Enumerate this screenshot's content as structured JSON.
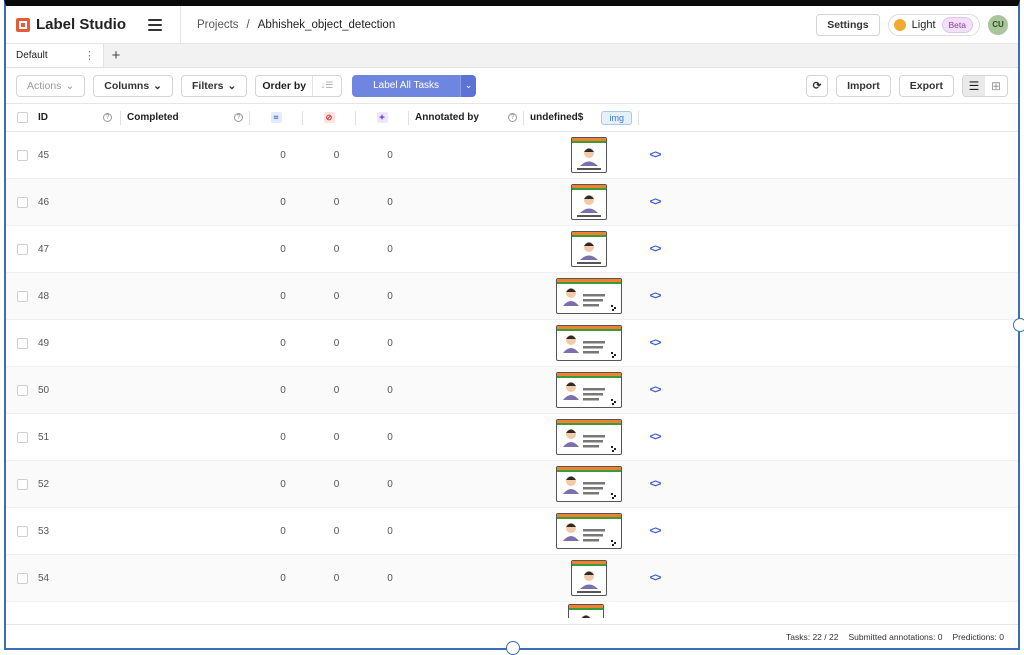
{
  "app": {
    "name": "Label Studio"
  },
  "breadcrumb": {
    "projects": "Projects",
    "separator": "/",
    "project": "Abhishek_object_detection"
  },
  "header": {
    "settings": "Settings",
    "theme": "Light",
    "beta": "Beta",
    "avatar": "CU"
  },
  "tabs": {
    "active": "Default",
    "add": "+",
    "menu": "⋮"
  },
  "toolbar": {
    "actions": "Actions",
    "columns": "Columns",
    "filters": "Filters",
    "order_by": "Order by",
    "label_all": "Label All Tasks",
    "import": "Import",
    "export": "Export"
  },
  "columns": {
    "id": "ID",
    "completed": "Completed",
    "annotated_by": "Annotated by",
    "undefined": "undefined$",
    "img_tag": "img"
  },
  "rows": [
    {
      "id": "45",
      "a": "0",
      "b": "0",
      "c": "0",
      "thumb": "square"
    },
    {
      "id": "46",
      "a": "0",
      "b": "0",
      "c": "0",
      "thumb": "square"
    },
    {
      "id": "47",
      "a": "0",
      "b": "0",
      "c": "0",
      "thumb": "square"
    },
    {
      "id": "48",
      "a": "0",
      "b": "0",
      "c": "0",
      "thumb": "wide"
    },
    {
      "id": "49",
      "a": "0",
      "b": "0",
      "c": "0",
      "thumb": "wide"
    },
    {
      "id": "50",
      "a": "0",
      "b": "0",
      "c": "0",
      "thumb": "wide"
    },
    {
      "id": "51",
      "a": "0",
      "b": "0",
      "c": "0",
      "thumb": "wide"
    },
    {
      "id": "52",
      "a": "0",
      "b": "0",
      "c": "0",
      "thumb": "wide"
    },
    {
      "id": "53",
      "a": "0",
      "b": "0",
      "c": "0",
      "thumb": "wide"
    },
    {
      "id": "54",
      "a": "0",
      "b": "0",
      "c": "0",
      "thumb": "square"
    }
  ],
  "thumb_text": {
    "name": "XXX XXXX",
    "id": "XXXX XXXX"
  },
  "footer": {
    "tasks": "Tasks: 22 / 22",
    "submitted": "Submitted annotations: 0",
    "predictions": "Predictions: 0"
  },
  "colors": {
    "accent": "#6f86e0",
    "brand": "#e65c3a",
    "frame": "#3b6fb6"
  }
}
